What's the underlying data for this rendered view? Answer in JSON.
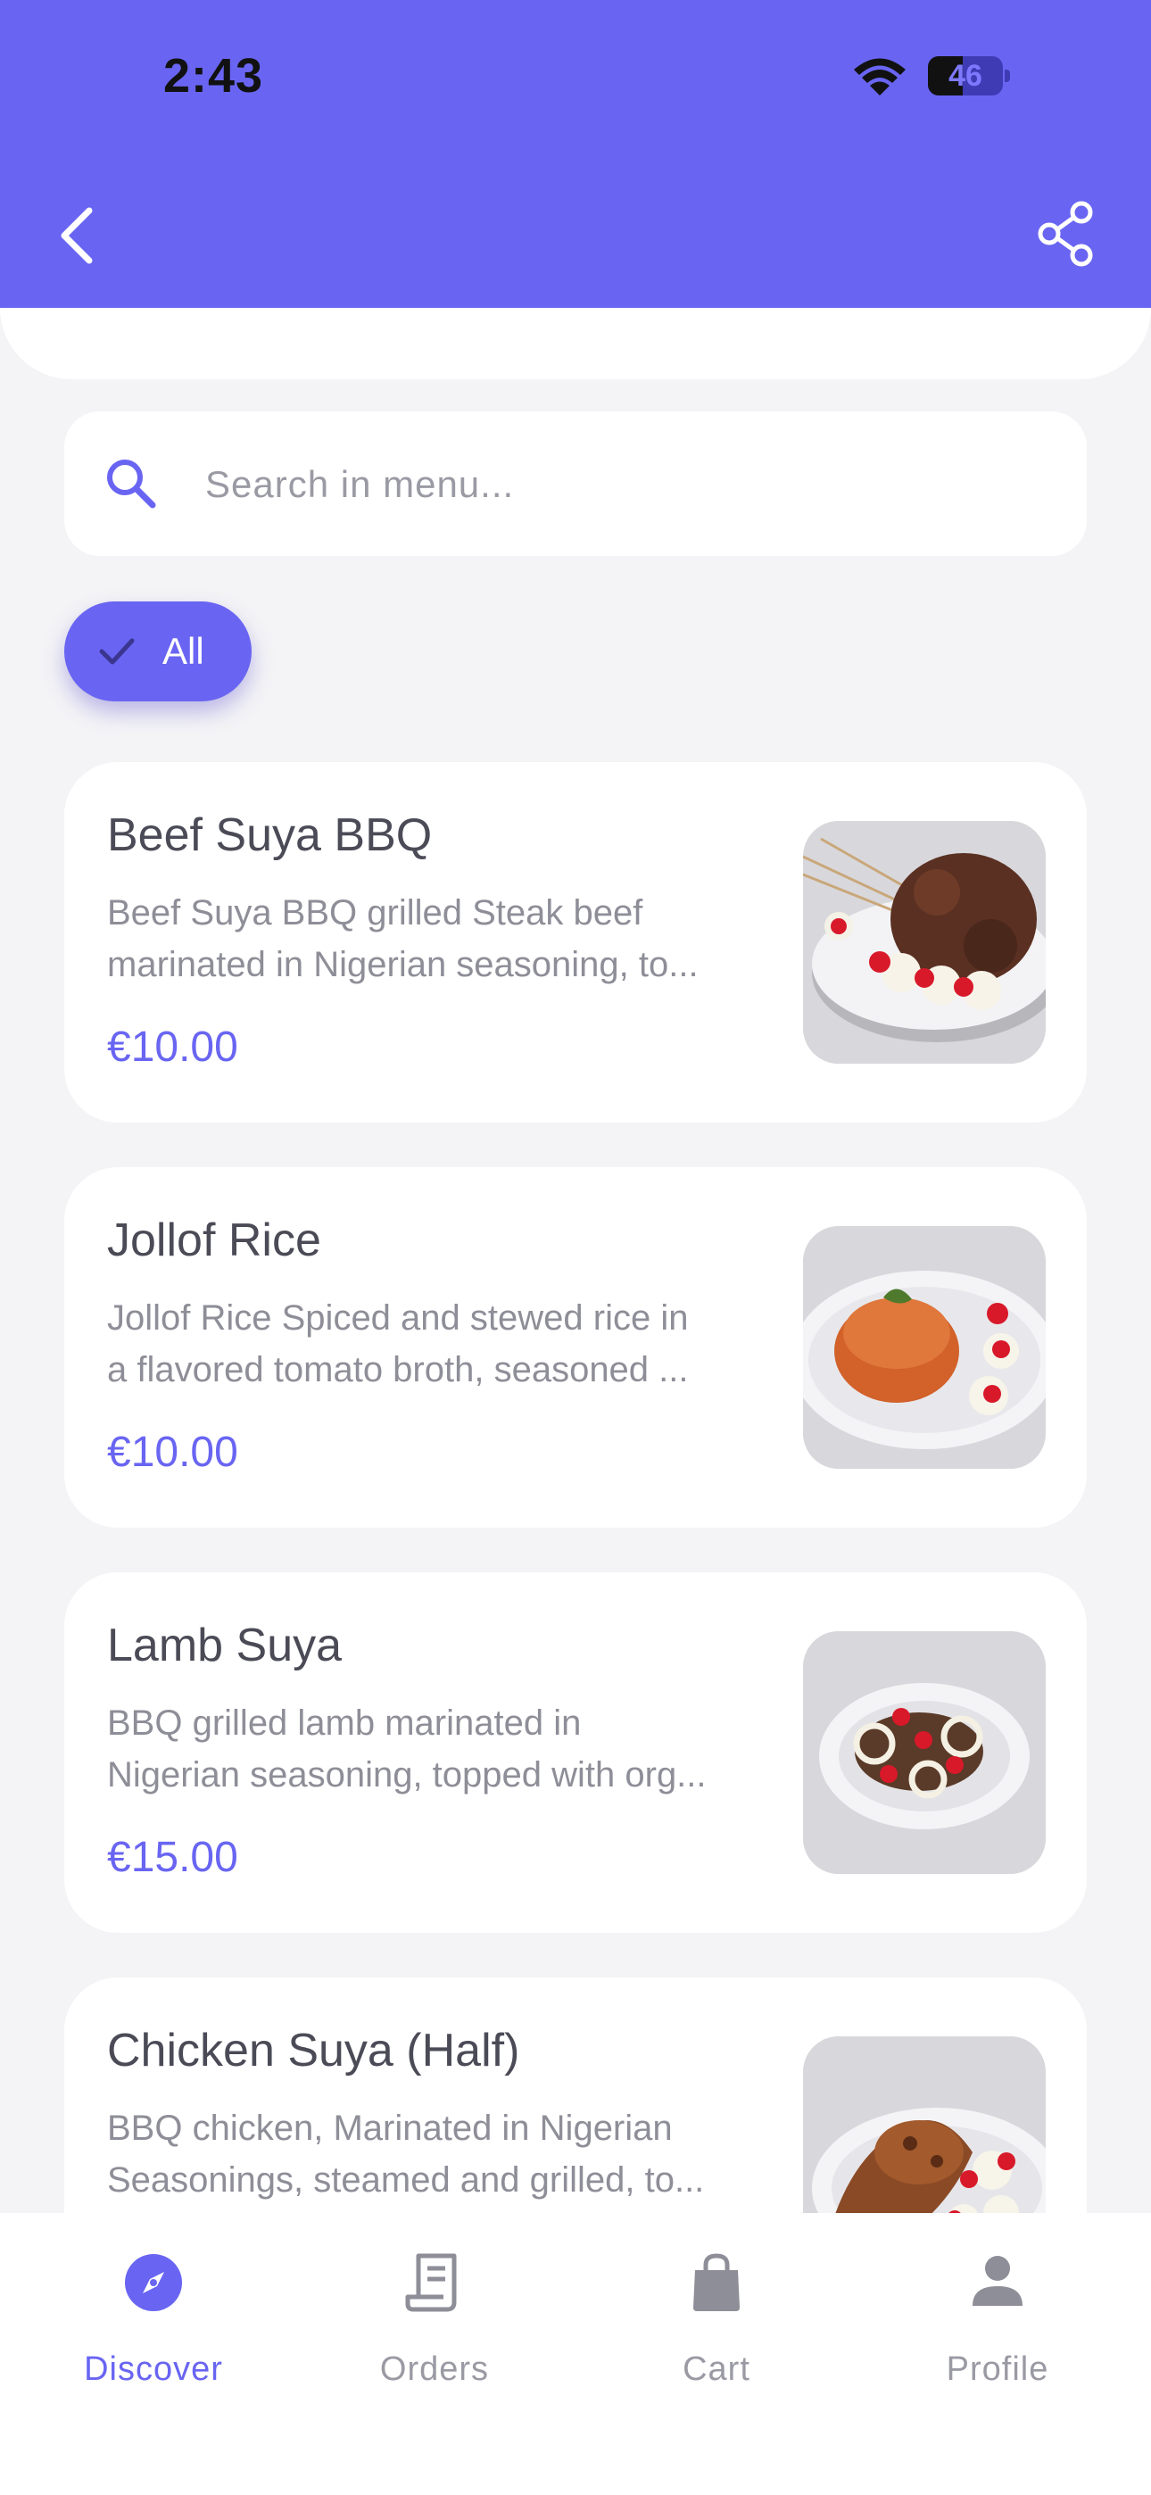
{
  "status_bar": {
    "time": "2:43",
    "battery": "46",
    "battery_level": 0.46
  },
  "colors": {
    "accent": "#6965f2",
    "background": "#f4f4f6",
    "card": "#ffffff",
    "muted_text": "#9a9aa4"
  },
  "header": {
    "back_icon": "chevron-left-icon",
    "share_icon": "share-icon"
  },
  "search": {
    "placeholder": "Search in menu...",
    "value": "",
    "icon": "search-icon"
  },
  "filters": [
    {
      "label": "All",
      "selected": true,
      "icon": "check-icon"
    }
  ],
  "menu_items": [
    {
      "name": "Beef Suya BBQ",
      "description_lines": [
        "Beef Suya BBQ grilled Steak beef",
        "marinated in Nigerian seasoning, to..."
      ],
      "price": "€10.00"
    },
    {
      "name": "Jollof Rice",
      "description_lines": [
        "Jollof Rice Spiced and stewed rice in",
        "a flavored tomato broth, seasoned ..."
      ],
      "price": "€10.00"
    },
    {
      "name": "Lamb Suya",
      "description_lines": [
        " BBQ grilled lamb marinated in",
        "Nigerian seasoning, topped with org..."
      ],
      "price": "€15.00"
    },
    {
      "name": "Chicken Suya (Half)",
      "description_lines": [
        "BBQ chicken, Marinated in Nigerian",
        "Seasonings, steamed and grilled, to..."
      ],
      "price": ""
    }
  ],
  "tabs": [
    {
      "label": "Discover",
      "icon": "compass-icon",
      "active": true
    },
    {
      "label": "Orders",
      "icon": "receipt-icon",
      "active": false
    },
    {
      "label": "Cart",
      "icon": "shopping-bag-icon",
      "active": false
    },
    {
      "label": "Profile",
      "icon": "person-icon",
      "active": false
    }
  ]
}
